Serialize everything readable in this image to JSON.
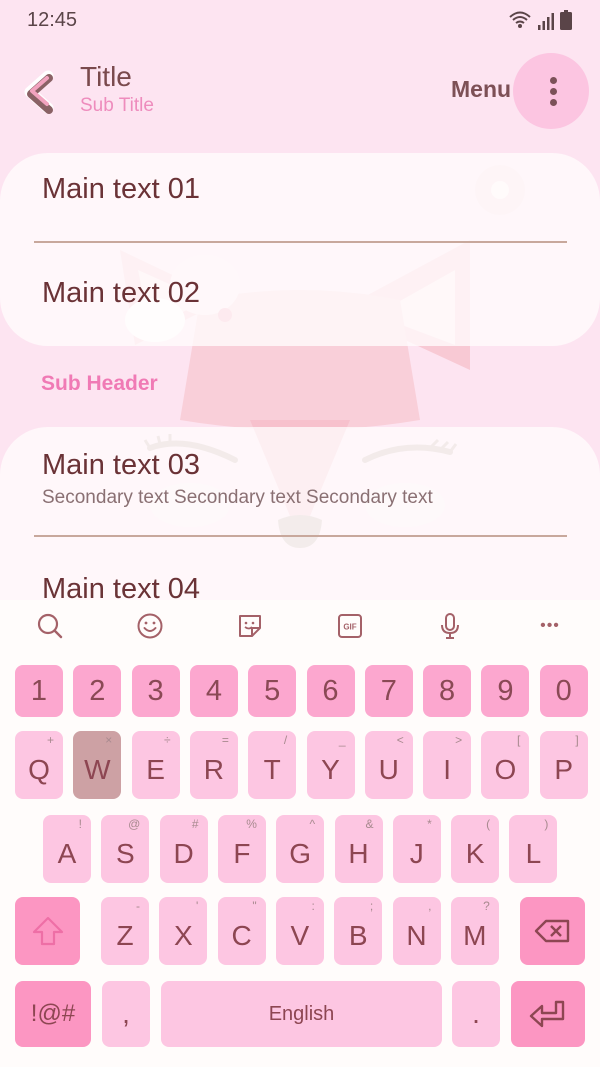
{
  "status_bar": {
    "time": "12:45",
    "icons": [
      "wifi-icon",
      "signal-icon",
      "battery-icon"
    ]
  },
  "app_bar": {
    "back_icon": "chevron-left-icon",
    "title": "Title",
    "subtitle": "Sub Title",
    "menu_label": "Menu",
    "more_icon": "more-vertical-icon"
  },
  "list_group_1": {
    "items": [
      {
        "main": "Main text 01"
      },
      {
        "main": "Main text 02"
      }
    ]
  },
  "sub_header": "Sub Header",
  "list_group_2": {
    "items": [
      {
        "main": "Main text 03",
        "secondary": "Secondary text Secondary text Secondary text"
      },
      {
        "main": "Main text 04"
      }
    ]
  },
  "keyboard": {
    "toolbar": [
      "search-icon",
      "emoji-icon",
      "sticker-icon",
      "gif-icon",
      "microphone-icon",
      "more-horizontal-icon"
    ],
    "gif_label": "GIF",
    "more_label": "•••",
    "number_row": [
      "1",
      "2",
      "3",
      "4",
      "5",
      "6",
      "7",
      "8",
      "9",
      "0"
    ],
    "row1": [
      {
        "key": "Q",
        "hint": "+"
      },
      {
        "key": "W",
        "hint": "×"
      },
      {
        "key": "E",
        "hint": "÷"
      },
      {
        "key": "R",
        "hint": "="
      },
      {
        "key": "T",
        "hint": "/"
      },
      {
        "key": "Y",
        "hint": "_"
      },
      {
        "key": "U",
        "hint": "<"
      },
      {
        "key": "I",
        "hint": ">"
      },
      {
        "key": "O",
        "hint": "["
      },
      {
        "key": "P",
        "hint": "]"
      }
    ],
    "row2": [
      {
        "key": "A",
        "hint": "!"
      },
      {
        "key": "S",
        "hint": "@"
      },
      {
        "key": "D",
        "hint": "#"
      },
      {
        "key": "F",
        "hint": "%"
      },
      {
        "key": "G",
        "hint": "^"
      },
      {
        "key": "H",
        "hint": "&"
      },
      {
        "key": "J",
        "hint": "*"
      },
      {
        "key": "K",
        "hint": "("
      },
      {
        "key": "L",
        "hint": ")"
      }
    ],
    "row3": [
      {
        "key": "Z",
        "hint": "-"
      },
      {
        "key": "X",
        "hint": "'"
      },
      {
        "key": "C",
        "hint": "\""
      },
      {
        "key": "V",
        "hint": ":"
      },
      {
        "key": "B",
        "hint": ";"
      },
      {
        "key": "N",
        "hint": ","
      },
      {
        "key": "M",
        "hint": "?"
      }
    ],
    "pressed_key": "W",
    "shift_icon": "shift-icon",
    "backspace_icon": "backspace-icon",
    "symbols_label": "!@#",
    "comma_label": ",",
    "space_label": "English",
    "period_label": ".",
    "enter_icon": "enter-icon"
  },
  "colors": {
    "background": "#fde4f1",
    "accent": "#f07ab5",
    "number_key": "#fca7cf",
    "letter_key": "#fdc6e2",
    "function_key": "#fc96c2",
    "key_text": "#8d4652"
  }
}
